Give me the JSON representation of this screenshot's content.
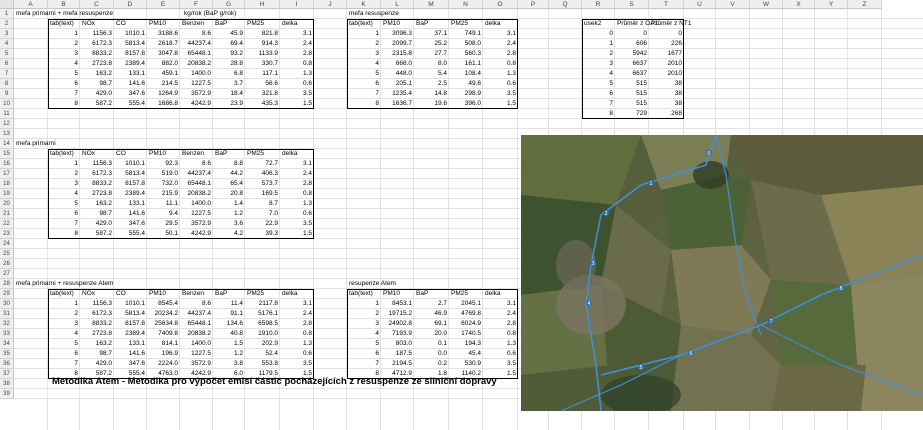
{
  "columns": [
    "A",
    "B",
    "C",
    "D",
    "E",
    "F",
    "G",
    "H",
    "I",
    "J",
    "K",
    "L",
    "M",
    "N",
    "O",
    "P",
    "Q",
    "R",
    "S",
    "T",
    "U",
    "V",
    "W",
    "X",
    "Y",
    "Z"
  ],
  "rows": [
    "1",
    "2",
    "3",
    "4",
    "5",
    "6",
    "7",
    "8",
    "9",
    "10",
    "11",
    "12",
    "13",
    "14",
    "15",
    "16",
    "17",
    "18",
    "19",
    "20",
    "21",
    "22",
    "23",
    "24",
    "25",
    "26",
    "27",
    "28",
    "29",
    "30",
    "31",
    "32",
    "33",
    "34",
    "35",
    "36",
    "37",
    "38",
    "39"
  ],
  "table1": {
    "title": "mefa primarni + mefa resuspenze",
    "units": "kg/rok (BaP g/rok)",
    "headers": [
      "tab(text)",
      "NOx",
      "CO",
      "PM10",
      "Benzen",
      "BaP",
      "PM25",
      "delka"
    ],
    "rows": [
      [
        "1",
        "1156.3",
        "1010.1",
        "3188.6",
        "8.6",
        "45.9",
        "821.8",
        "3.1"
      ],
      [
        "2",
        "6172.3",
        "5813.4",
        "2618.7",
        "44237.4",
        "69.4",
        "914.3",
        "2.4"
      ],
      [
        "3",
        "8833.2",
        "8157.8",
        "3047.8",
        "65448.1",
        "93.2",
        "1133.9",
        "2.8"
      ],
      [
        "4",
        "2723.8",
        "2389.4",
        "882.0",
        "20838.2",
        "28.8",
        "330.7",
        "0.8"
      ],
      [
        "5",
        "163.2",
        "133.1",
        "459.1",
        "1400.0",
        "6.8",
        "117.1",
        "1.3"
      ],
      [
        "6",
        "98.7",
        "141.6",
        "214.5",
        "1227.5",
        "3.7",
        "56.6",
        "0.6"
      ],
      [
        "7",
        "429.0",
        "347.6",
        "1264.9",
        "3572.9",
        "18.4",
        "321.8",
        "3.5"
      ],
      [
        "8",
        "587.2",
        "555.4",
        "1686.8",
        "4242.9",
        "23.9",
        "435.3",
        "1.5"
      ]
    ]
  },
  "table2": {
    "title": "mefa resuspenze",
    "headers": [
      "tab(text)",
      "PM10",
      "BaP",
      "PM25",
      "delka"
    ],
    "rows": [
      [
        "1",
        "3096.3",
        "37.1",
        "749.1",
        "3.1"
      ],
      [
        "2",
        "2099.7",
        "25.2",
        "508.0",
        "2.4"
      ],
      [
        "3",
        "2315.8",
        "27.7",
        "560.3",
        "2.8"
      ],
      [
        "4",
        "666.0",
        "8.0",
        "161.1",
        "0.8"
      ],
      [
        "5",
        "448.0",
        "5.4",
        "108.4",
        "1.3"
      ],
      [
        "6",
        "205.1",
        "2.5",
        "49.6",
        "0.6"
      ],
      [
        "7",
        "1235.4",
        "14.8",
        "298.9",
        "3.5"
      ],
      [
        "8",
        "1636.7",
        "19.6",
        "396.0",
        "1.5"
      ]
    ]
  },
  "table3": {
    "headers": [
      "usek2",
      "Průměr z OA1",
      "Průměr z NT1"
    ],
    "rows": [
      [
        "0",
        "0",
        "0"
      ],
      [
        "1",
        "606",
        "226"
      ],
      [
        "2",
        "5942",
        "1677"
      ],
      [
        "3",
        "6637",
        "2010"
      ],
      [
        "4",
        "6637",
        "2010"
      ],
      [
        "5",
        "515",
        "38"
      ],
      [
        "6",
        "515",
        "38"
      ],
      [
        "7",
        "515",
        "38"
      ],
      [
        "8",
        "729",
        "268"
      ]
    ]
  },
  "table4": {
    "title": "mefa primarni",
    "headers": [
      "tab(text)",
      "NOx",
      "CO",
      "PM10",
      "Benzen",
      "BaP",
      "PM25",
      "delka"
    ],
    "rows": [
      [
        "1",
        "1156.3",
        "1010.1",
        "92.3",
        "8.6",
        "8.8",
        "72.7",
        "3.1"
      ],
      [
        "2",
        "6172.3",
        "5813.4",
        "519.0",
        "44237.4",
        "44.2",
        "406.3",
        "2.4"
      ],
      [
        "3",
        "8833.2",
        "8157.8",
        "732.0",
        "65448.1",
        "65.4",
        "573.7",
        "2.8"
      ],
      [
        "4",
        "2723.8",
        "2389.4",
        "215.9",
        "20838.2",
        "20.8",
        "169.5",
        "0.8"
      ],
      [
        "5",
        "163.2",
        "133.1",
        "11.1",
        "1400.0",
        "1.4",
        "8.7",
        "1.3"
      ],
      [
        "6",
        "98.7",
        "141.6",
        "9.4",
        "1227.5",
        "1.2",
        "7.0",
        "0.6"
      ],
      [
        "7",
        "429.0",
        "347.6",
        "29.5",
        "3572.9",
        "3.6",
        "22.9",
        "3.5"
      ],
      [
        "8",
        "587.2",
        "555.4",
        "50.1",
        "4242.9",
        "4.2",
        "39.3",
        "1.5"
      ]
    ]
  },
  "table5": {
    "title": "mefa primarni + resuspenze Atem",
    "headers": [
      "tab(text)",
      "NOx",
      "CO",
      "PM10",
      "Benzen",
      "BaP",
      "PM25",
      "delka"
    ],
    "rows": [
      [
        "1",
        "1156.3",
        "1010.1",
        "8545.4",
        "8.6",
        "11.4",
        "2117.8",
        "3.1"
      ],
      [
        "2",
        "6172.3",
        "5813.4",
        "20234.2",
        "44237.4",
        "91.1",
        "5176.1",
        "2.4"
      ],
      [
        "3",
        "8833.2",
        "8157.8",
        "25634.8",
        "65448.1",
        "134.6",
        "6598.5",
        "2.8"
      ],
      [
        "4",
        "2723.8",
        "2389.4",
        "7409.8",
        "20838.2",
        "40.8",
        "1910.0",
        "0.8"
      ],
      [
        "5",
        "163.2",
        "133.1",
        "814.1",
        "1400.0",
        "1.5",
        "202.9",
        "1.3"
      ],
      [
        "6",
        "98.7",
        "141.6",
        "196.9",
        "1227.5",
        "1.2",
        "52.4",
        "0.6"
      ],
      [
        "7",
        "429.0",
        "347.6",
        "2224.0",
        "3572.9",
        "3.8",
        "553.8",
        "3.5"
      ],
      [
        "8",
        "587.2",
        "555.4",
        "4763.0",
        "4242.9",
        "6.0",
        "1179.5",
        "1.5"
      ]
    ]
  },
  "table6": {
    "title": "resupenze Atem",
    "headers": [
      "tab(text)",
      "PM10",
      "BaP",
      "PM25",
      "delka"
    ],
    "rows": [
      [
        "1",
        "8453.1",
        "2.7",
        "2045.1",
        "3.1"
      ],
      [
        "2",
        "19715.2",
        "46.9",
        "4769.8",
        "2.4"
      ],
      [
        "3",
        "24902.8",
        "69.1",
        "6024.9",
        "2.8"
      ],
      [
        "4",
        "7193.9",
        "20.0",
        "1740.5",
        "0.8"
      ],
      [
        "5",
        "803.0",
        "0.1",
        "194.3",
        "1.3"
      ],
      [
        "6",
        "187.5",
        "0.0",
        "45.4",
        "0.6"
      ],
      [
        "7",
        "2194.5",
        "0.2",
        "530.9",
        "3.5"
      ],
      [
        "8",
        "4712.9",
        "1.8",
        "1140.2",
        "1.5"
      ]
    ]
  },
  "footer_title": "Metodika Atem - Metodika pro výpočet emisí částic pocházejících z resuspenze ze silniční dopravy",
  "map": {
    "labels": [
      "0",
      "1",
      "2",
      "3",
      "4",
      "5",
      "6",
      "7",
      "8"
    ],
    "road_color": "#3f8fdc"
  }
}
